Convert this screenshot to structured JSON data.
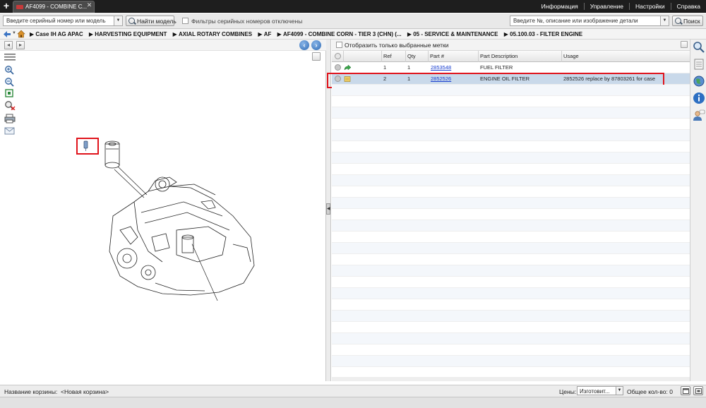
{
  "topbar": {
    "tab_label": "AF4099 - COMBINE C...",
    "menu": [
      "Информация",
      "Управление",
      "Настройки",
      "Справка"
    ]
  },
  "search": {
    "serial_placeholder": "Введите серийный номер или модель",
    "find_model_label": "Найти модель",
    "filter_label": "Фильтры серийных номеров отключены",
    "part_search_placeholder": "Введите №, описание или изображение детали",
    "search_button_label": "Поиск"
  },
  "breadcrumb": [
    "Case IH AG APAC",
    "HARVESTING EQUIPMENT",
    "AXIAL ROTARY COMBINES",
    "AF",
    "AF4099 - COMBINE CORN - TIER 3 (CHN) (...",
    "05 - SERVICE & MAINTENANCE",
    "05.100.03 - FILTER ENGINE"
  ],
  "drawing": {
    "callout_label": "1",
    "accent_color": "#e0141c"
  },
  "parts_panel": {
    "show_selected_label": "Отобразить только выбранные метки",
    "columns": [
      "Ref",
      "Qty",
      "Part #",
      "Part Description",
      "Usage"
    ],
    "rows": [
      {
        "ref": "1",
        "qty": "1",
        "part": "2853548",
        "description": "FUEL FILTER",
        "usage": "",
        "icon": "green-arrow-icon"
      },
      {
        "ref": "2",
        "qty": "1",
        "part": "2852526",
        "description": "ENGINE OIL FILTER",
        "usage": "2852526 replace by 87803261 for case",
        "icon": "note-icon"
      }
    ]
  },
  "bottom": {
    "cart_label": "Название корзины:",
    "cart_value": "<Новая корзина>",
    "prices_label": "Цены:",
    "manufacturer_value": "Изготовит...",
    "total_label": "Общее кол-во: 0"
  }
}
